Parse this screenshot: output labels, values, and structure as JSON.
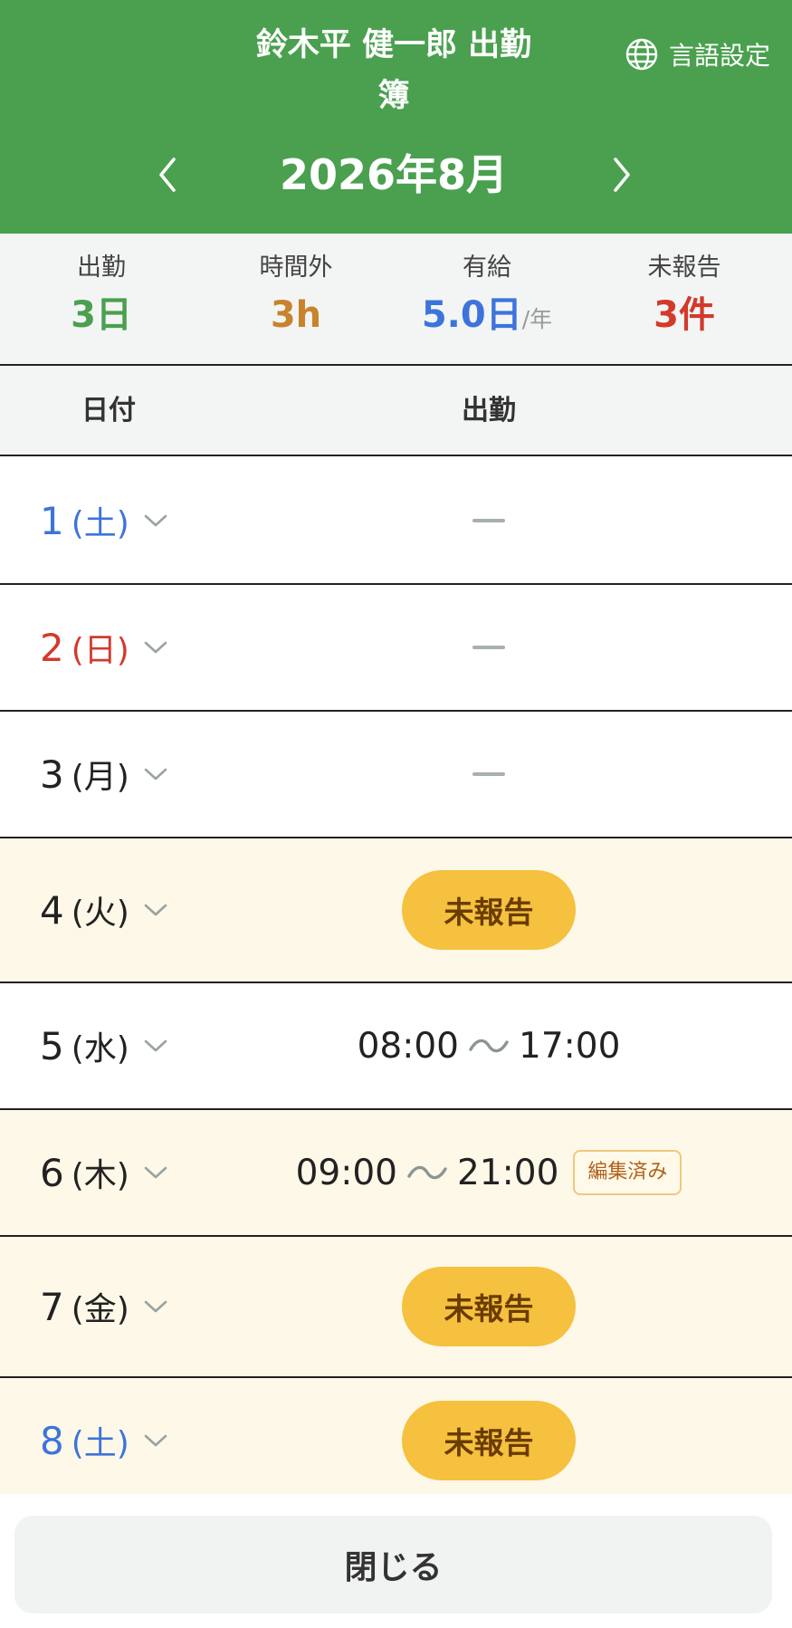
{
  "header": {
    "title_line1": "鈴木平 健一郎 出勤",
    "title_line2": "簿",
    "lang_label": "言語設定",
    "month": "2026年8月"
  },
  "summary": {
    "attendance": {
      "label": "出勤",
      "value": "3日",
      "color": "#4aa04f"
    },
    "overtime": {
      "label": "時間外",
      "value": "3h",
      "color": "#c8832c"
    },
    "paid_leave": {
      "label": "有給",
      "value": "5.0日",
      "unit": "/年",
      "color": "#3d74dc"
    },
    "unreported": {
      "label": "未報告",
      "value": "3件",
      "color": "#d33a2c"
    }
  },
  "columns": {
    "date": "日付",
    "attendance": "出勤"
  },
  "rows": [
    {
      "day": "1",
      "weekday": "(土)",
      "status": "none"
    },
    {
      "day": "2",
      "weekday": "(日)",
      "status": "none"
    },
    {
      "day": "3",
      "weekday": "(月)",
      "status": "none"
    },
    {
      "day": "4",
      "weekday": "(火)",
      "status": "unreported",
      "label": "未報告"
    },
    {
      "day": "5",
      "weekday": "(水)",
      "status": "time",
      "start": "08:00",
      "end": "17:00"
    },
    {
      "day": "6",
      "weekday": "(木)",
      "status": "time",
      "start": "09:00",
      "end": "21:00",
      "badge": "編集済み"
    },
    {
      "day": "7",
      "weekday": "(金)",
      "status": "unreported",
      "label": "未報告"
    },
    {
      "day": "8",
      "weekday": "(土)",
      "status": "unreported",
      "label": "未報告"
    }
  ],
  "footer": {
    "close_label": "閉じる"
  },
  "icons": {
    "lang": "globe-icon",
    "prev": "chevron-left-icon",
    "next": "chevron-right-icon",
    "expand": "chevron-down-icon",
    "dash": "dash-icon",
    "tilde": "tilde-icon"
  },
  "colors": {
    "header_bg": "#4aa04f",
    "row_highlight_bg": "#fdf8e8",
    "pill_bg": "#f5c13e",
    "saturday": "#3d74dc",
    "sunday": "#d33a2c"
  }
}
